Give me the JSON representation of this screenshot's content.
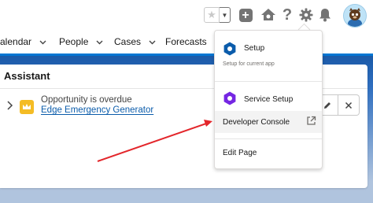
{
  "header": {
    "favorites_star": "★",
    "favorites_menu": "▼",
    "add_symbol": "+",
    "help_symbol": "?",
    "icons": [
      "star-icon",
      "chevron-down-icon",
      "plus-icon",
      "trailhead-icon",
      "help-icon",
      "gear-icon",
      "bell-icon",
      "avatar-icon"
    ]
  },
  "nav": {
    "items": [
      {
        "label": "alendar"
      },
      {
        "label": "People"
      },
      {
        "label": "Cases"
      },
      {
        "label": "Forecasts"
      }
    ]
  },
  "assistant": {
    "title": "Assistant",
    "item": {
      "status": "Opportunity is overdue",
      "link": "Edge Emergency Generator"
    }
  },
  "menu": {
    "setup": {
      "label": "Setup",
      "subtitle": "Setup for current app"
    },
    "service_setup": {
      "label": "Service Setup"
    },
    "developer_console": {
      "label": "Developer Console"
    },
    "edit_page": {
      "label": "Edit Page"
    }
  },
  "colors": {
    "brand_blue": "#0176d3",
    "setup_icon": "#0b5cab",
    "service_icon": "#7526e3",
    "crown": "#f4bc25",
    "arrow": "#e3262b"
  }
}
